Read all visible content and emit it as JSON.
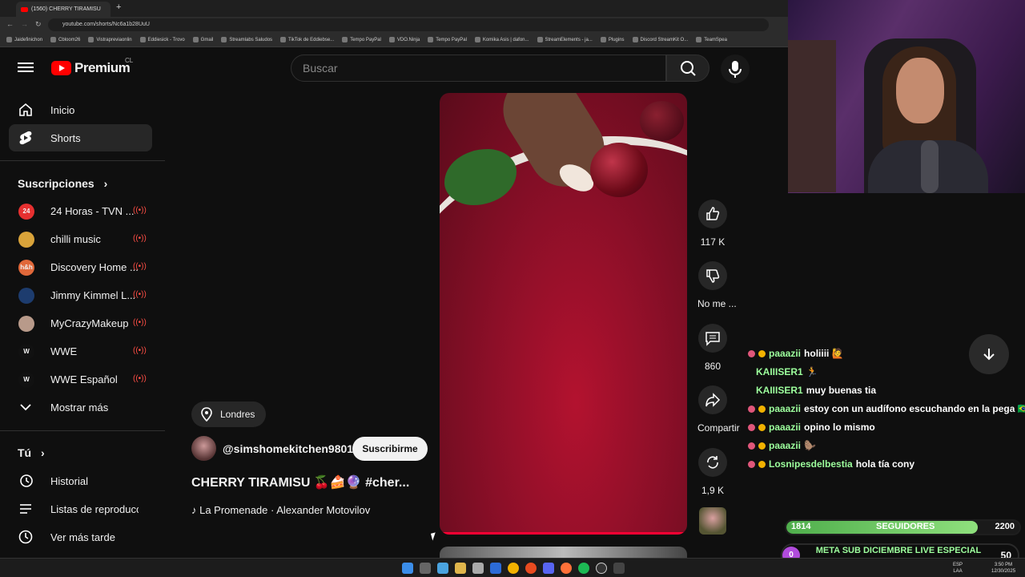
{
  "browser": {
    "tab_title": "(1560) CHERRY TIRAMISU",
    "url": "youtube.com/shorts/Nc6a1b28UuU",
    "bookmarks": [
      "Jaidefinichon",
      "Cbloom26",
      "Vistrapreviaonlin",
      "Eddiesick - Trovo",
      "Gmail",
      "Streamlabs Saludos",
      "TikTok de Eddiebse...",
      "Tempo PayPal",
      "VDO.Ninja",
      "Tempo PayPal",
      "Komika Asis | dafon...",
      "StreamElements - ja...",
      "Plugins",
      "Discord StreamKit O...",
      "TeamSpea"
    ]
  },
  "youtube": {
    "logo_text": "Premium",
    "region": "CL",
    "search_placeholder": "Buscar",
    "nav": [
      {
        "label": "Inicio"
      },
      {
        "label": "Shorts"
      }
    ],
    "subscriptions_title": "Suscripciones",
    "subscriptions": [
      {
        "label": "24 Horas - TVN ...",
        "avatar_text": "24",
        "color": "#e63030"
      },
      {
        "label": "chilli music",
        "avatar_text": "",
        "color": "#d9a33a"
      },
      {
        "label": "Discovery Home ...",
        "avatar_text": "h&h",
        "color": "#e0683a"
      },
      {
        "label": "Jimmy Kimmel L...",
        "avatar_text": "",
        "color": "#1d3c6e"
      },
      {
        "label": "MyCrazyMakeup",
        "avatar_text": "",
        "color": "#b89a8a"
      },
      {
        "label": "WWE",
        "avatar_text": "W",
        "color": "#111111"
      },
      {
        "label": "WWE Español",
        "avatar_text": "W",
        "color": "#111111"
      }
    ],
    "show_more": "Mostrar más",
    "you_title": "Tú",
    "you_items": [
      {
        "label": "Historial"
      },
      {
        "label": "Listas de reproducc..."
      },
      {
        "label": "Ver más tarde"
      }
    ],
    "short": {
      "location": "Londres",
      "channel": "@simshomekitchen9801",
      "subscribe": "Suscribirme",
      "title": "CHERRY TIRAMISU 🍒🍰🔮 #cher...",
      "music": "♪ La Promenade · Alexander Motovilov",
      "likes": "117 K",
      "dislike": "No me ...",
      "comments": "860",
      "share": "Compartir",
      "remix": "1,9 K"
    }
  },
  "chat": [
    {
      "user": "paaazii",
      "msg": "holiiii 🙋",
      "color": "#9dff9d"
    },
    {
      "user": "KAIIISER1",
      "msg": "🏃",
      "color": "#9dff9d"
    },
    {
      "user": "KAIIISER1",
      "msg": "muy buenas tia",
      "color": "#9dff9d"
    },
    {
      "user": "paaazii",
      "msg": "estoy con un audífono escuchando en la pega 🇧🇷",
      "color": "#9dff9d"
    },
    {
      "user": "paaazii",
      "msg": "opino lo mismo",
      "color": "#9dff9d"
    },
    {
      "user": "paaazii",
      "msg": "🦫",
      "color": "#9dff9d"
    },
    {
      "user": "Losnipesdelbestia",
      "msg": "hola tía cony",
      "color": "#9dff9d"
    }
  ],
  "goals": {
    "followers_current": "1814",
    "followers_label": "SEGUIDORES",
    "followers_target": "2200",
    "followers_fraction": 0.82,
    "sub_goal_count": "0",
    "sub_goal_label": "META SUB DICIEMBRE LIVE ESPECIAL",
    "sub_goal_target": "50"
  },
  "taskbar": {
    "lang": "ESP",
    "layout": "LAA",
    "time": "3:50 PM",
    "date": "12/30/2025"
  }
}
